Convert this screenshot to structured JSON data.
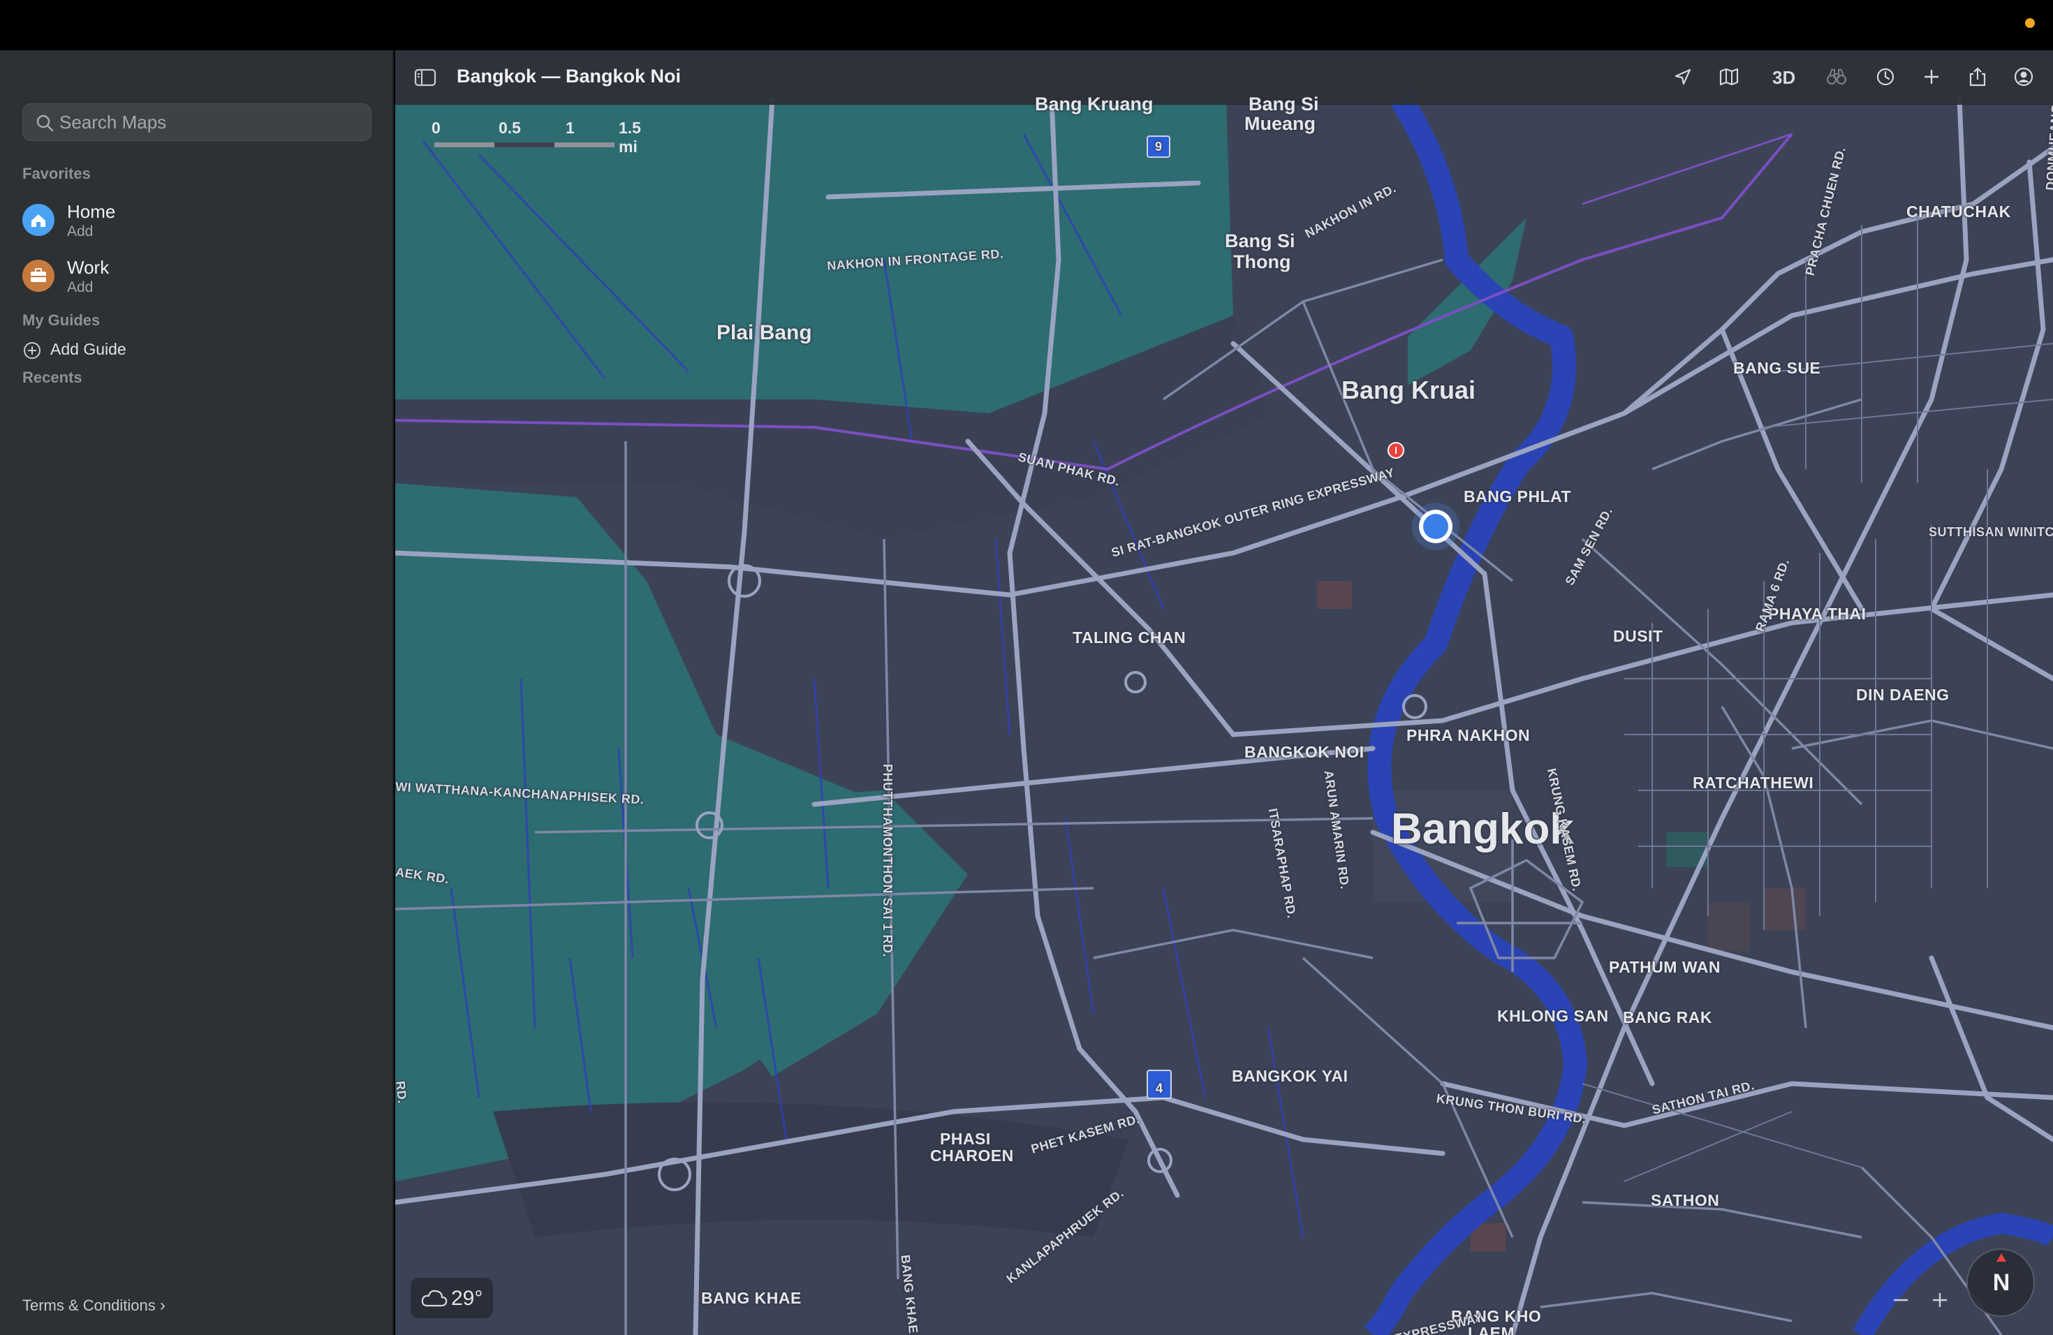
{
  "window": {
    "title": "Bangkok — Bangkok Noi"
  },
  "sidebar": {
    "search_placeholder": "Search Maps",
    "favorites_title": "Favorites",
    "favorites": [
      {
        "title": "Home",
        "subtitle": "Add",
        "icon": "house-icon",
        "color": "#4aa3f2"
      },
      {
        "title": "Work",
        "subtitle": "Add",
        "icon": "briefcase-icon",
        "color": "#c77a3e"
      }
    ],
    "guides_title": "My Guides",
    "add_guide_label": "Add Guide",
    "recents_title": "Recents",
    "terms_label": "Terms & Conditions"
  },
  "toolbar": {
    "three_d_label": "3D",
    "icons": [
      "location-arrow-icon",
      "map-mode-icon",
      "3d-toggle",
      "binoculars-icon",
      "clock-icon",
      "plus-icon",
      "share-icon",
      "account-icon"
    ]
  },
  "scale": {
    "ticks": [
      "0",
      "0.5",
      "1",
      "1.5 mi"
    ]
  },
  "map": {
    "labels": {
      "bangkok": "Bangkok",
      "bang_kruai": "Bang Kruai",
      "plai_bang": "Plai Bang",
      "bang_si_thong_1": "Bang Si",
      "bang_si_thong_2": "Thong",
      "bang_si_mueang_1": "Bang Si",
      "bang_si_mueang_2": "Mueang",
      "bang_kruang": "Bang Kruang",
      "bang_phlat": "BANG PHLAT",
      "bang_sue": "BANG SUE",
      "chatuchak": "CHATUCHAK",
      "dusit": "DUSIT",
      "phaya_thai": "PHAYA THAI",
      "din_daeng": "DIN DAENG",
      "taling_chan": "TALING CHAN",
      "phra_nakhon": "PHRA NAKHON",
      "bangkok_noi": "BANGKOK NOI",
      "ratchathewi": "RATCHATHEWI",
      "pathum_wan": "PATHUM WAN",
      "khlong_san": "KHLONG SAN",
      "bang_rak": "BANG RAK",
      "bangkok_yai": "BANGKOK YAI",
      "phasi_charoen_1": "PHASI",
      "phasi_charoen_2": "CHAROEN",
      "sathon": "SATHON",
      "bang_khae": "BANG KHAE",
      "bang_kho_laem_1": "BANG KHO",
      "bang_kho_laem_2": "LAEM"
    },
    "roads": {
      "nakhon_in_frontage": "NAKHON IN FRONTAGE RD.",
      "nakhon_in": "NAKHON IN RD.",
      "suan_phak": "SUAN PHAK RD.",
      "outer_ring": "SI RAT-BANGKOK OUTER RING EXPRESSWAY",
      "kanchanaphisek": "WI WATTHANA-KANCHANAPHISEK RD.",
      "aek": "AEK RD.",
      "rd": "RD.",
      "phutthamonthon": "PHUTTHAMONTHON SAI 1 RD.",
      "itsaraphap": "ITSARAPHAP RD.",
      "arun_amarin": "ARUN AMARIN RD.",
      "krung_kasem": "KRUNG KASEM RD.",
      "sam_sen": "SAM SEN RD.",
      "rama_6": "RAMA 6 RD.",
      "pracha_chuen": "PRACHA CHUEN RD.",
      "sutthisan": "SUTTHISAN WINITCH",
      "phet_kasem": "PHET KASEM RD.",
      "krung_thon_buri": "KRUNG THON BURI RD.",
      "sathon_tai": "SATHON TAI RD.",
      "kanlapaphruek": "KANLAPAPHRUEK RD.",
      "bang_khae_rd": "BANG KHAE RD.",
      "expressway": "EXPRESSWAY",
      "donmueang": "DONMUEANG"
    },
    "shields": [
      "4",
      "9"
    ],
    "weather": {
      "temperature": "29°",
      "icon": "cloud-icon"
    },
    "compass": "N"
  }
}
